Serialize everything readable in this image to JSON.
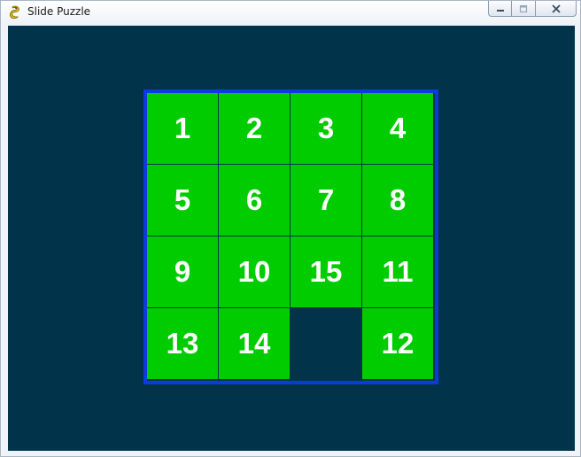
{
  "window": {
    "title": "Slide Puzzle"
  },
  "colors": {
    "background": "#01344a",
    "tile": "#00cc00",
    "tile_text": "#ffffff",
    "border": "#0a3cdc"
  },
  "icons": {
    "app": "pygame-snake-icon",
    "minimize": "minimize-icon",
    "maximize": "maximize-icon",
    "close": "close-icon"
  },
  "board": {
    "rows": [
      [
        "1",
        "2",
        "3",
        "4"
      ],
      [
        "5",
        "6",
        "7",
        "8"
      ],
      [
        "9",
        "10",
        "15",
        "11"
      ],
      [
        "13",
        "14",
        "",
        "12"
      ]
    ]
  }
}
